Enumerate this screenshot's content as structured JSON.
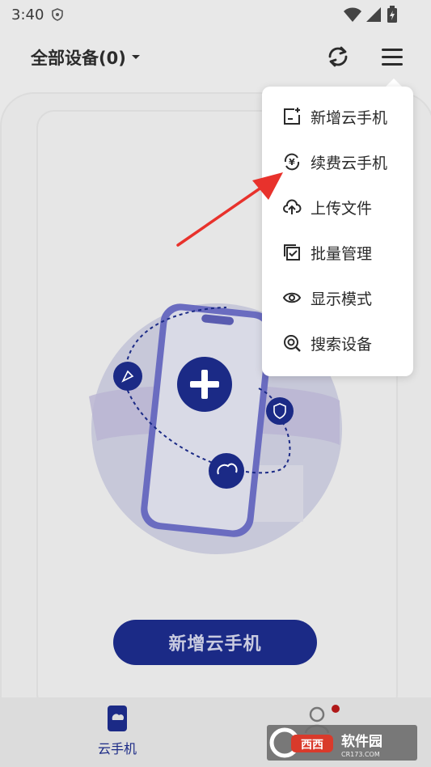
{
  "status_bar": {
    "time": "3:40"
  },
  "header": {
    "title": "全部设备(0)"
  },
  "main": {
    "add_button_label": "新增云手机"
  },
  "menu": {
    "items": [
      {
        "label": "新增云手机",
        "icon": "add-device-icon"
      },
      {
        "label": "续费云手机",
        "icon": "renew-yen-icon"
      },
      {
        "label": "上传文件",
        "icon": "upload-cloud-icon"
      },
      {
        "label": "批量管理",
        "icon": "batch-check-icon"
      },
      {
        "label": "显示模式",
        "icon": "eye-icon"
      },
      {
        "label": "搜索设备",
        "icon": "search-device-icon"
      }
    ]
  },
  "bottom_nav": {
    "items": [
      {
        "label": "云手机",
        "icon": "cloud-phone-icon"
      }
    ]
  },
  "watermark": {
    "text": "软件园",
    "subtext": "CR173.COM"
  },
  "colors": {
    "accent": "#1b2a86",
    "badge": "#b01818",
    "arrow": "#e8322c"
  }
}
